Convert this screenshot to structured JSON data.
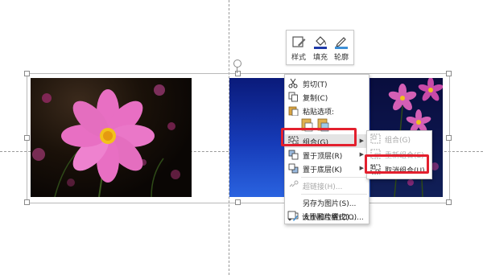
{
  "mini_toolbar": {
    "style_label": "样式",
    "fill_label": "填充",
    "outline_label": "轮廓"
  },
  "context_menu": {
    "items": [
      {
        "label": "剪切(T)",
        "icon": "scissors-icon",
        "enabled": true
      },
      {
        "label": "复制(C)",
        "icon": "copy-icon",
        "enabled": true
      },
      {
        "label": "粘贴选项:",
        "icon": "paste-icon",
        "enabled": true
      },
      {
        "label": "组合(G)",
        "icon": "group-icon",
        "enabled": true,
        "has_submenu": true
      },
      {
        "label": "置于顶层(R)",
        "icon": "bring-to-front-icon",
        "enabled": true,
        "has_submenu": true
      },
      {
        "label": "置于底层(K)",
        "icon": "send-to-back-icon",
        "enabled": true,
        "has_submenu": true
      },
      {
        "label": "超链接(H)...",
        "icon": "hyperlink-icon",
        "enabled": false
      },
      {
        "label": "另存为图片(S)...",
        "icon": "",
        "enabled": true
      },
      {
        "label": "大小和位置(Z)...",
        "icon": "size-position-icon",
        "enabled": true
      },
      {
        "label": "设置图片格式(O)...",
        "icon": "format-picture-icon",
        "enabled": true
      }
    ]
  },
  "submenu": {
    "items": [
      {
        "label": "组合(G)",
        "icon": "group-icon",
        "enabled": false
      },
      {
        "label": "重新组合(E)",
        "icon": "regroup-icon",
        "enabled": false
      },
      {
        "label": "取消组合(U)",
        "icon": "ungroup-icon",
        "enabled": true
      }
    ]
  },
  "colors": {
    "highlight_border": "#e3202e",
    "fill_swatch": "#1f3aa8",
    "outline_swatch": "#3d8fd6"
  }
}
